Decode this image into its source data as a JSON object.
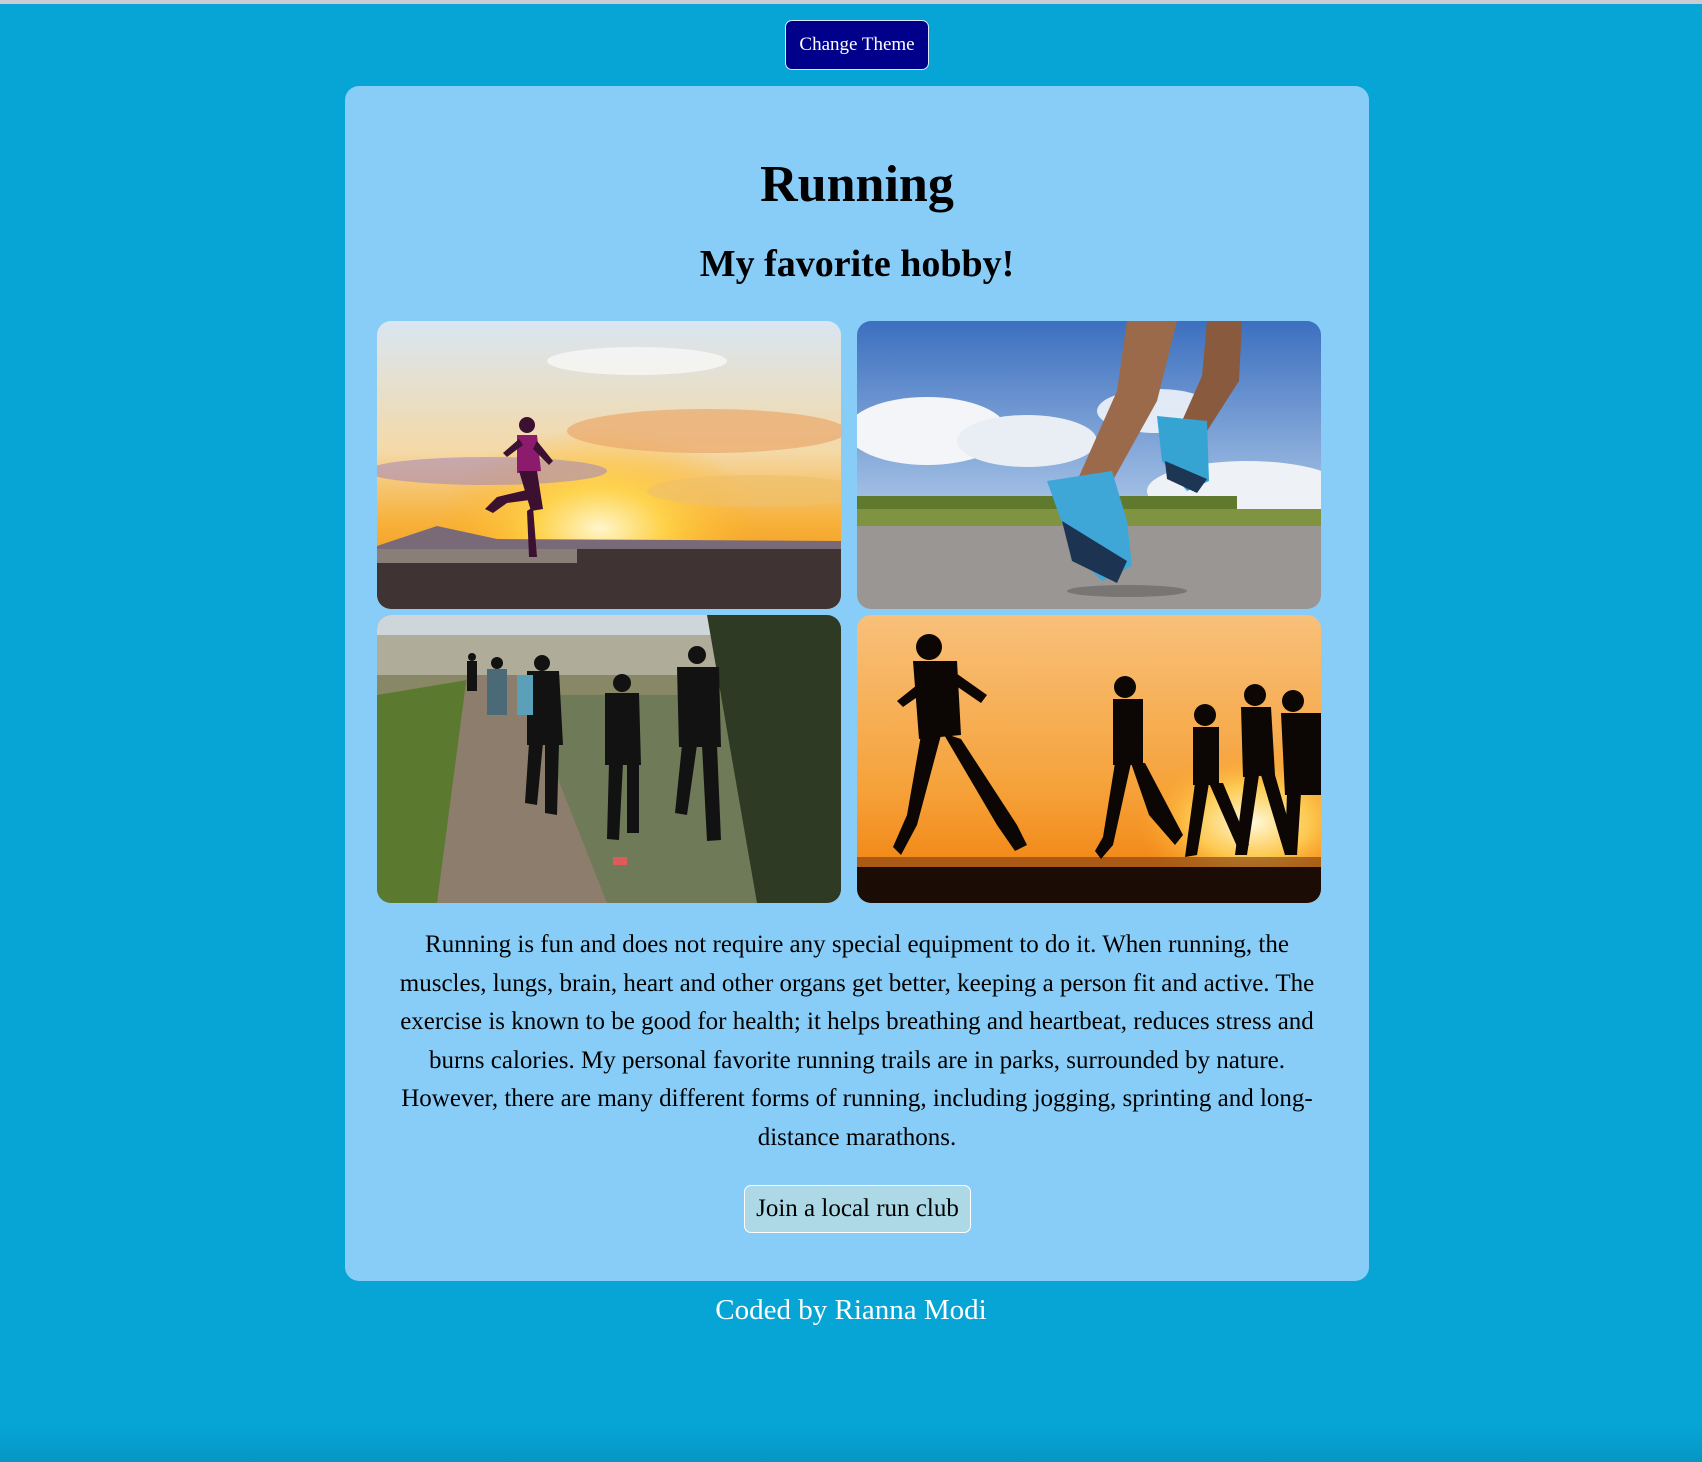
{
  "header": {
    "theme_button_label": "Change Theme"
  },
  "card": {
    "title": "Running",
    "subtitle": "My favorite hobby!",
    "photos": [
      {
        "name": "runner-at-sunset-photo"
      },
      {
        "name": "running-shoes-photo"
      },
      {
        "name": "trail-run-group-photo"
      },
      {
        "name": "sunset-runners-silhouette-photo"
      }
    ],
    "description": "Running is fun and does not require any special equipment to do it. When running, the muscles, lungs, brain, heart and other organs get better, keeping a person fit and active. The exercise is known to be good for health; it helps breathing and heartbeat, reduces stress and burns calories. My personal favorite running trails are in parks, surrounded by nature. However, there are many different forms of running, including jogging, sprinting and long-distance marathons.",
    "cta_label": "Join a local run club"
  },
  "footer": {
    "credit": "Coded by Rianna Modi"
  },
  "colors": {
    "page_background": "#06a5d6",
    "card_background": "#87cdf7",
    "theme_button": "#00008b",
    "cta_button": "#add8e6"
  }
}
